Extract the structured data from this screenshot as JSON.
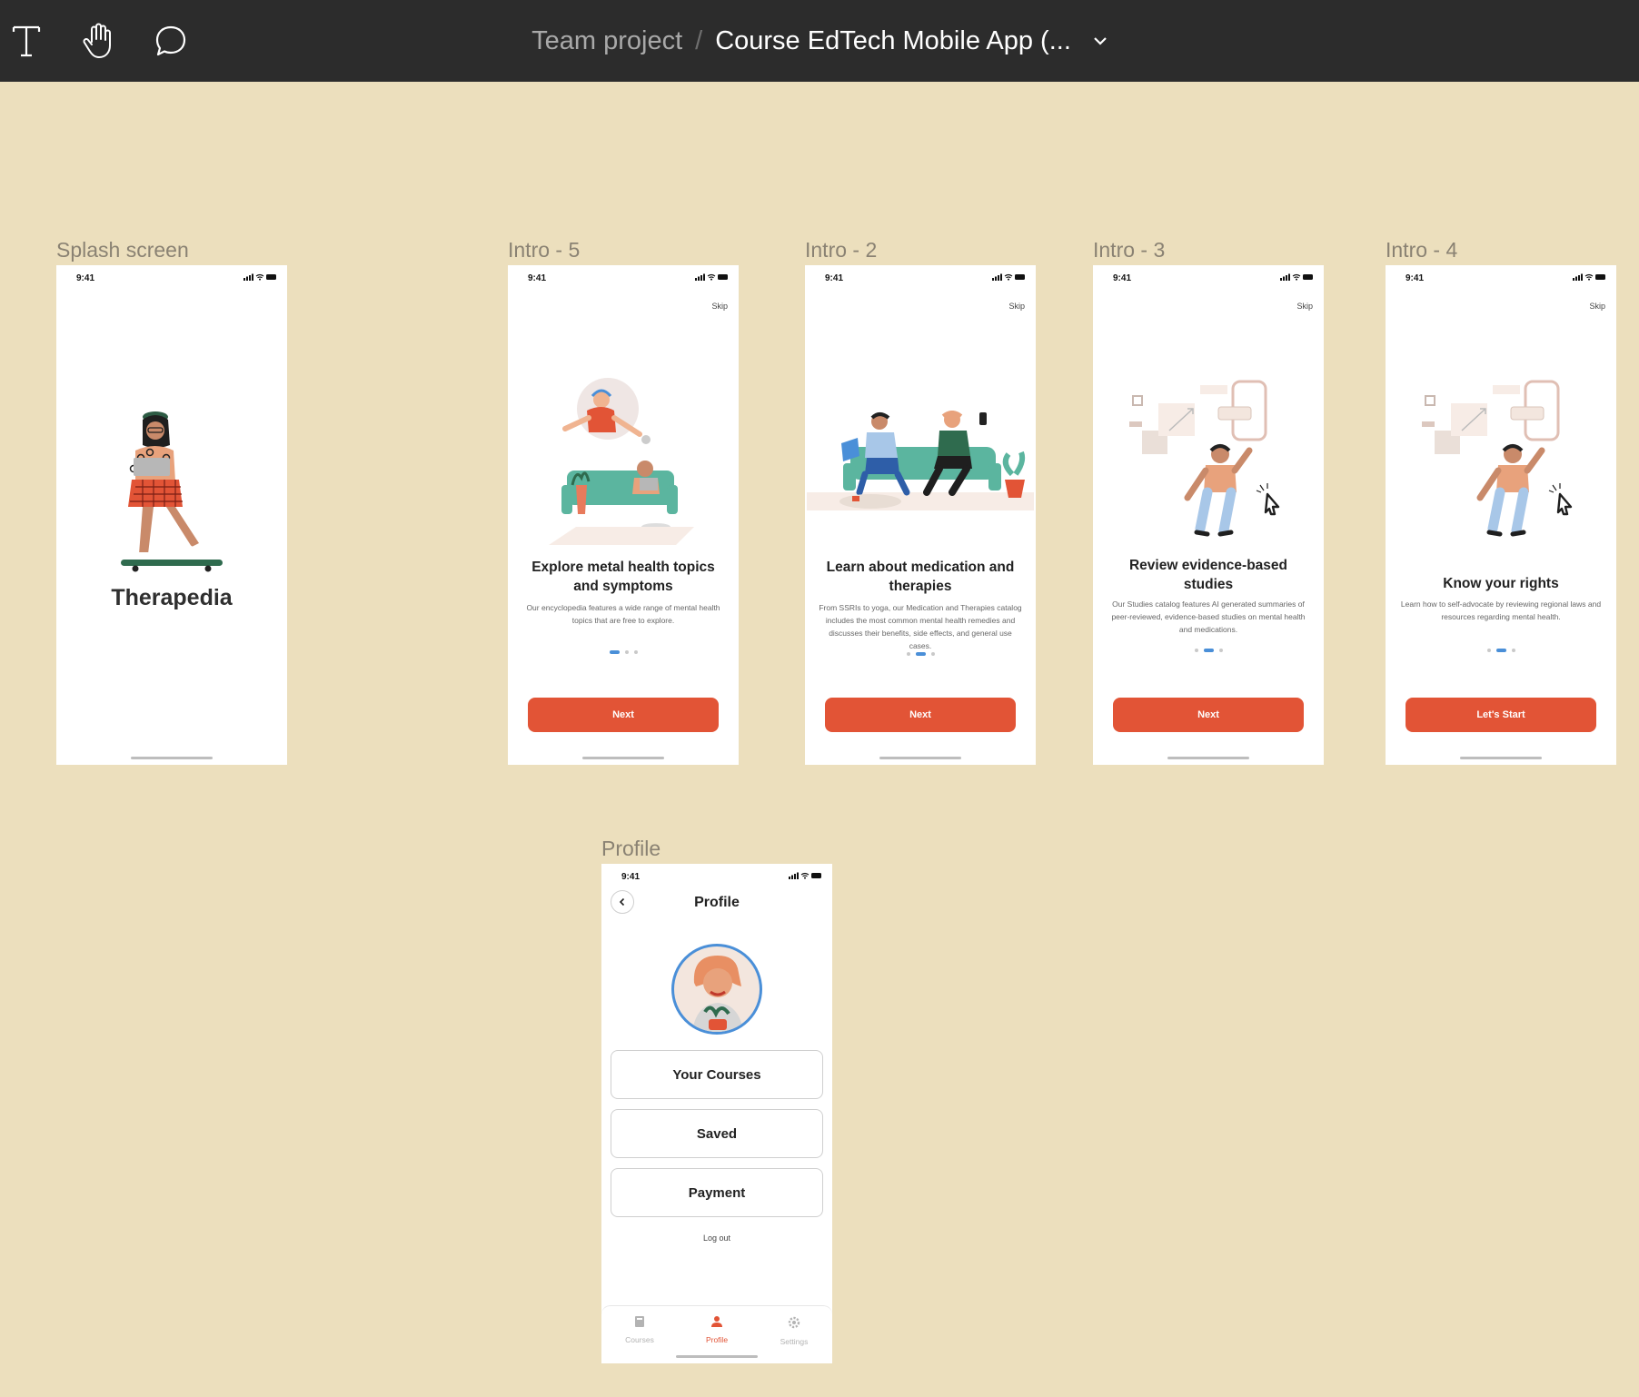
{
  "toolbar": {
    "tools": [
      "text-tool",
      "hand-tool",
      "comment-tool"
    ],
    "project": "Team project",
    "separator": "/",
    "file_name": "Course EdTech Mobile App (..."
  },
  "status_time": "9:41",
  "frames": {
    "splash": {
      "label": "Splash screen",
      "brand": "Therapedia"
    },
    "intro5": {
      "label": "Intro - 5",
      "skip": "Skip",
      "title": "Explore metal health topics and symptoms",
      "desc": "Our encyclopedia features a wide range of mental health topics that are free to explore.",
      "button": "Next"
    },
    "intro2": {
      "label": "Intro - 2",
      "skip": "Skip",
      "title": "Learn about medication and therapies",
      "desc": "From SSRIs to yoga, our Medication and Therapies catalog includes the most common mental health remedies and discusses their benefits, side effects, and general use cases.",
      "button": "Next"
    },
    "intro3": {
      "label": "Intro - 3",
      "skip": "Skip",
      "title": "Review evidence-based studies",
      "desc": "Our Studies catalog features AI generated summaries of peer-reviewed, evidence-based studies on mental health and medications.",
      "button": "Next"
    },
    "intro4": {
      "label": "Intro - 4",
      "skip": "Skip",
      "title": "Know your rights",
      "desc": "Learn how to self-advocate by reviewing regional laws and resources regarding mental health.",
      "button": "Let's Start"
    },
    "profile": {
      "label": "Profile",
      "title": "Profile",
      "menu": [
        "Your Courses",
        "Saved",
        "Payment"
      ],
      "logout": "Log out",
      "tabs": [
        {
          "label": "Courses",
          "icon": "book-icon"
        },
        {
          "label": "Profile",
          "icon": "person-icon",
          "active": true
        },
        {
          "label": "Settings",
          "icon": "gear-icon"
        }
      ]
    }
  },
  "colors": {
    "canvas": "#ecdfbd",
    "toolbar": "#2c2c2c",
    "accent": "#e25436",
    "dot_active": "#4a8fd8"
  }
}
